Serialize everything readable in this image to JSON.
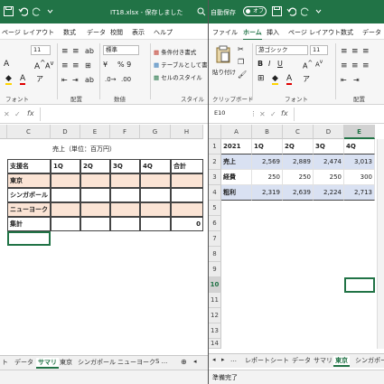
{
  "left": {
    "title": "IT18.xlsx  -  保存しました",
    "tabs": [
      "ページ レイアウト",
      "数式",
      "データ",
      "校閲",
      "表示",
      "ヘルプ"
    ],
    "font_size": "11",
    "number_format": "標準",
    "number_symbols": "% 9",
    "style_items": [
      "条件付き書式",
      "テーブルとして書式設定",
      "セルのスタイル"
    ],
    "group_labels": [
      "フォント",
      "配置",
      "数値",
      "スタイル"
    ],
    "columns": [
      "C",
      "D",
      "E",
      "F",
      "G",
      "H"
    ],
    "caption": "売上（単位：百万円）",
    "table": {
      "headers": [
        "支援名",
        "1Q",
        "2Q",
        "3Q",
        "4Q",
        "合計"
      ],
      "rows": [
        "東京",
        "シンガポール",
        "ニューヨーク"
      ],
      "total_label": "集計",
      "total_value": "0"
    },
    "sheet_tabs": [
      "ト",
      "データ",
      "サマリ",
      "東京",
      "シンガポール",
      "ニューヨーク",
      "S ..."
    ]
  },
  "right": {
    "autosave_label": "自動保存",
    "autosave_state": "オフ",
    "tabs": [
      "ファイル",
      "ホーム",
      "挿入",
      "ページ レイアウト",
      "数式",
      "データ"
    ],
    "font_name": "游ゴシック",
    "font_size": "11",
    "paste_label": "貼り付け",
    "group_labels": [
      "クリップボード",
      "フォント",
      "配置"
    ],
    "name_box": "E10",
    "columns": [
      "A",
      "B",
      "C",
      "D",
      "E"
    ],
    "rows": [
      "1",
      "2",
      "3",
      "4",
      "5",
      "6",
      "7",
      "8",
      "9",
      "10",
      "11",
      "12",
      "13",
      "14"
    ],
    "sheet": {
      "header": [
        "2021",
        "1Q",
        "2Q",
        "3Q",
        "4Q"
      ],
      "data": [
        [
          "売上",
          "2,569",
          "2,889",
          "2,474",
          "3,013"
        ],
        [
          "経費",
          "250",
          "250",
          "250",
          "300"
        ],
        [
          "粗利",
          "2,319",
          "2,639",
          "2,224",
          "2,713"
        ]
      ]
    },
    "sheet_tabs": [
      "レポートシート",
      "データ",
      "サマリ",
      "東京",
      "シンガポール"
    ],
    "status": "準備完了"
  },
  "colors": {
    "excel_green": "#217346",
    "pink_fill": "#fbe4d5",
    "blue_fill": "#d9e1f2"
  }
}
